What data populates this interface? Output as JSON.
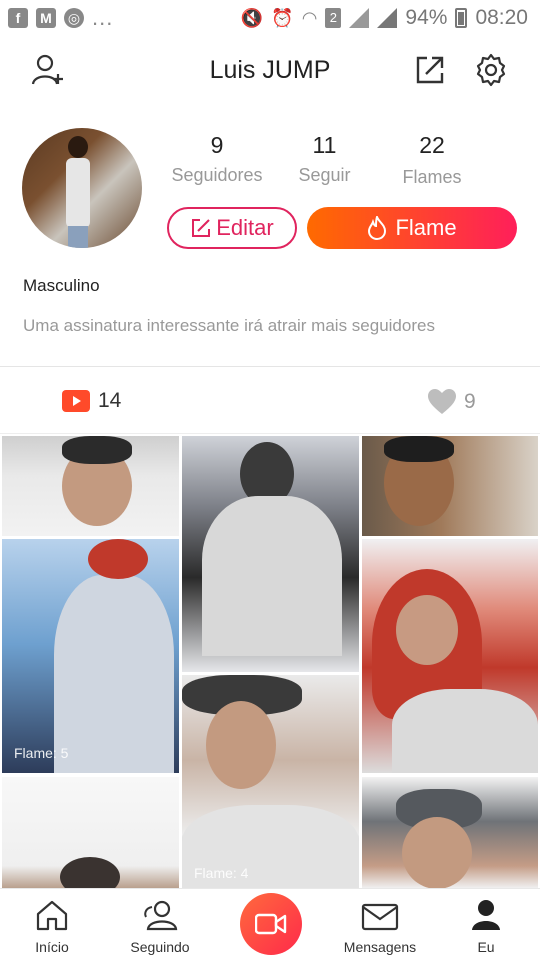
{
  "status_bar": {
    "left_icons": [
      "facebook-icon",
      "gmail-icon",
      "chrome-icon"
    ],
    "overflow": "...",
    "battery": "94%",
    "time": "08:20",
    "sim_badge": "2"
  },
  "header": {
    "title": "Luis JUMP",
    "left_icon": "add-user-icon",
    "right_icons": [
      "share-icon",
      "settings-icon"
    ]
  },
  "profile": {
    "stats": [
      {
        "value": "9",
        "label": "Seguidores"
      },
      {
        "value": "11",
        "label": "Seguir"
      },
      {
        "value": "22",
        "label": "Flames"
      }
    ],
    "edit_label": "Editar",
    "flame_label": "Flame",
    "gender": "Masculino",
    "signature": "Uma assinatura interessante irá atrair mais seguidores"
  },
  "tabs": {
    "videos_count": "14",
    "likes_count": "9"
  },
  "grid": {
    "labels": [
      "Flame: 5",
      "Flame: 4"
    ]
  },
  "nav": {
    "items": [
      {
        "label": "Início"
      },
      {
        "label": "Seguindo"
      },
      {
        "label": "Mensagens"
      },
      {
        "label": "Eu"
      }
    ]
  },
  "colors": {
    "accent": "#e0245e",
    "flame_start": "#ff6a00",
    "flame_end": "#ff1f5a"
  }
}
